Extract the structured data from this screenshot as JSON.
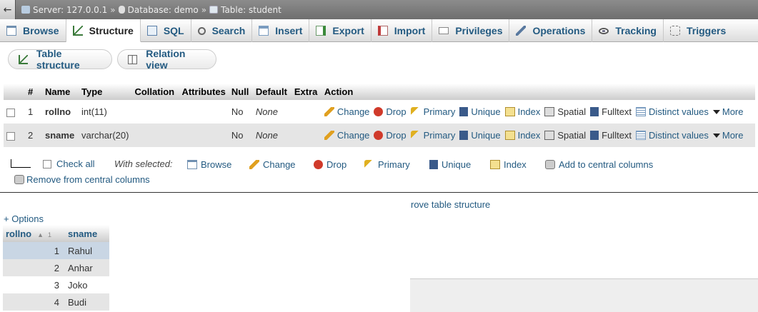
{
  "breadcrumb": {
    "back": "←",
    "server": "Server: 127.0.0.1",
    "database": "Database: demo",
    "table": "Table: student",
    "separator": "»"
  },
  "tabs": [
    {
      "label": "Browse",
      "icon": "browse-icon"
    },
    {
      "label": "Structure",
      "icon": "structure-icon",
      "active": true
    },
    {
      "label": "SQL",
      "icon": "sql-icon"
    },
    {
      "label": "Search",
      "icon": "search-icon"
    },
    {
      "label": "Insert",
      "icon": "insert-icon"
    },
    {
      "label": "Export",
      "icon": "export-icon"
    },
    {
      "label": "Import",
      "icon": "import-icon"
    },
    {
      "label": "Privileges",
      "icon": "privileges-icon"
    },
    {
      "label": "Operations",
      "icon": "wrench-icon"
    },
    {
      "label": "Tracking",
      "icon": "eye-icon"
    },
    {
      "label": "Triggers",
      "icon": "triggers-icon"
    }
  ],
  "subtabs": {
    "table_structure": "Table structure",
    "relation_view": "Relation view"
  },
  "structure": {
    "headers": [
      "#",
      "Name",
      "Type",
      "Collation",
      "Attributes",
      "Null",
      "Default",
      "Extra",
      "Action"
    ],
    "rows": [
      {
        "num": "1",
        "name": "rollno",
        "type": "int(11)",
        "collation": "",
        "attributes": "",
        "null": "No",
        "default": "None",
        "extra": ""
      },
      {
        "num": "2",
        "name": "sname",
        "type": "varchar(20)",
        "collation": "",
        "attributes": "",
        "null": "No",
        "default": "None",
        "extra": ""
      }
    ],
    "actions": {
      "change": "Change",
      "drop": "Drop",
      "primary": "Primary",
      "unique": "Unique",
      "index": "Index",
      "spatial": "Spatial",
      "fulltext": "Fulltext",
      "distinct": "Distinct values",
      "more": "More"
    }
  },
  "with_selected": {
    "check_all": "Check all",
    "label": "With selected:",
    "browse": "Browse",
    "change": "Change",
    "drop": "Drop",
    "primary": "Primary",
    "unique": "Unique",
    "index": "Index",
    "add_central": "Add to central columns",
    "remove_central": "Remove from central columns"
  },
  "improve_link": "rove table structure",
  "options_link": "+ Options",
  "results": {
    "headers": [
      "rollno",
      "sname"
    ],
    "sort_index": "1",
    "rows": [
      {
        "rollno": "1",
        "sname": "Rahul"
      },
      {
        "rollno": "2",
        "sname": "Anhar"
      },
      {
        "rollno": "3",
        "sname": "Joko"
      },
      {
        "rollno": "4",
        "sname": "Budi"
      }
    ]
  },
  "colors": {
    "link": "#235a81",
    "row_alt": "#e5e5e5",
    "row_selected": "#c9d6e4",
    "crumb_bg": "#7a7a7a"
  }
}
